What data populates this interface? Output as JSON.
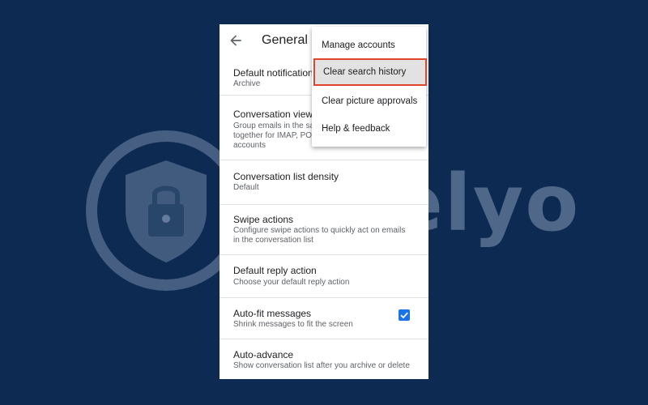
{
  "watermark": {
    "brand": "Safelyo"
  },
  "appbar": {
    "title": "General se"
  },
  "settings": [
    {
      "title": "Default notification",
      "sub": [
        "Archive"
      ]
    },
    {
      "title": "Conversation view",
      "sub": [
        "Group emails in the sa",
        "together for IMAP, POI",
        "accounts"
      ]
    },
    {
      "title": "Conversation list density",
      "sub": [
        "Default"
      ]
    },
    {
      "title": "Swipe actions",
      "sub": [
        "Configure swipe actions to quickly act on emails",
        "in the conversation list"
      ]
    },
    {
      "title": "Default reply action",
      "sub": [
        "Choose your default reply action"
      ]
    },
    {
      "title": "Auto-fit messages",
      "sub": [
        "Shrink messages to fit the screen"
      ],
      "checked": true
    },
    {
      "title": "Auto-advance",
      "sub": [
        "Show conversation list after you archive or delete"
      ]
    }
  ],
  "menu": {
    "items": [
      {
        "label": "Manage accounts"
      },
      {
        "label": "Clear search history",
        "highlighted": true
      },
      {
        "label": "Clear picture approvals"
      },
      {
        "label": "Help & feedback"
      }
    ]
  },
  "colors": {
    "background": "#0c2a52",
    "checkbox": "#1a73e8",
    "highlight_border": "#e0452a"
  },
  "icons": {
    "back": "arrow-back-icon",
    "checkbox": "checkbox-checked-icon",
    "logo": "shield-lock-icon"
  }
}
